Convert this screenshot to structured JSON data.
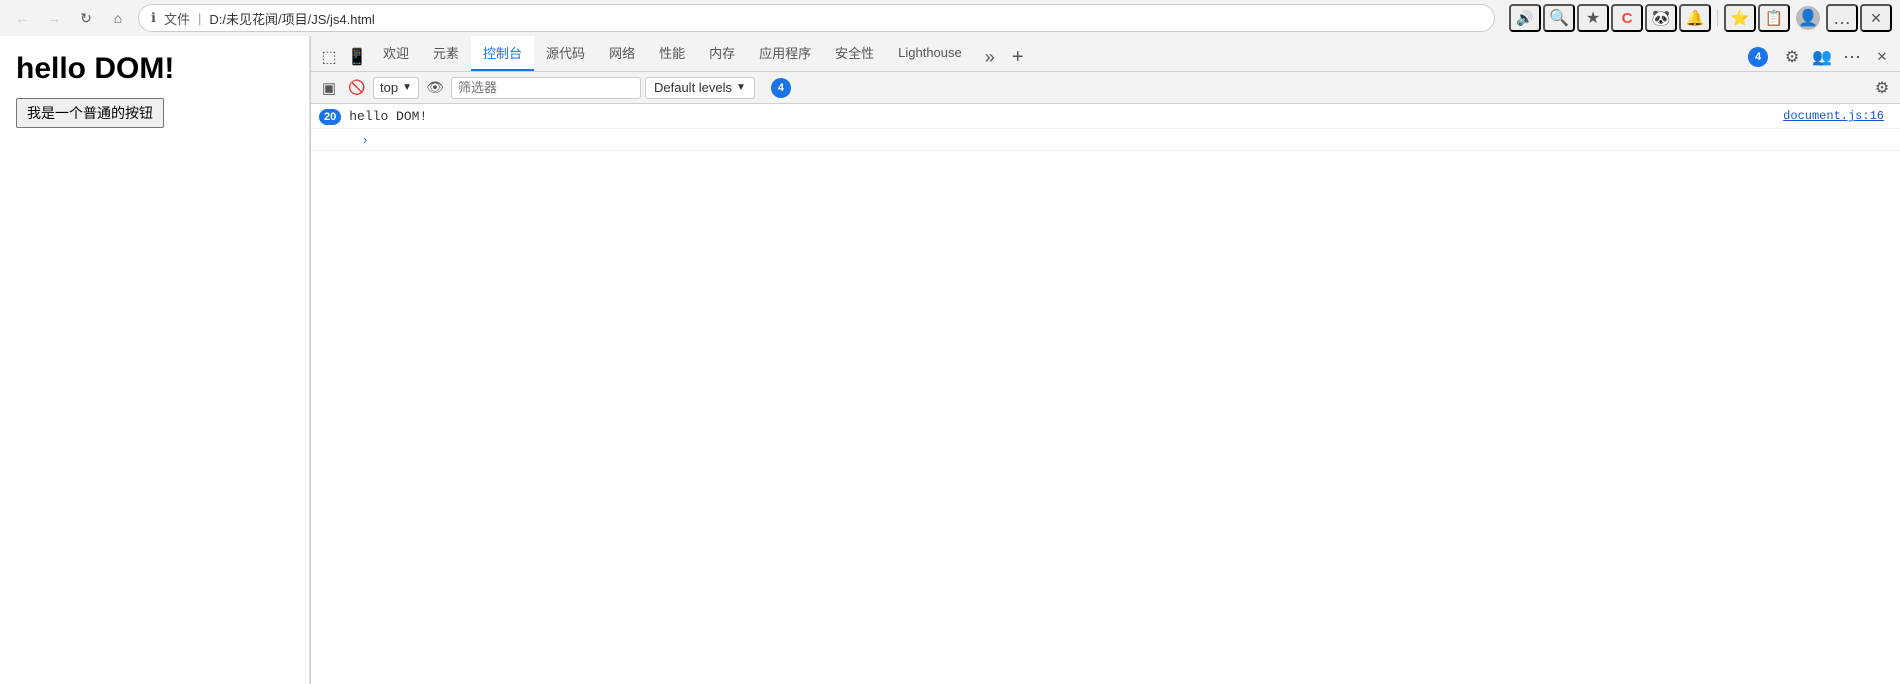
{
  "browser": {
    "back_disabled": true,
    "forward_disabled": true,
    "reload_title": "刷新",
    "home_title": "主页",
    "address": {
      "info_icon": "ℹ",
      "file_label": "文件",
      "separator": "|",
      "url": "D:/未见花闻/项目/JS/js4.html"
    }
  },
  "title_bar_actions": {
    "read_aloud": "📖",
    "search": "🔍",
    "favorites": "☆",
    "brand_icon": "C",
    "ext1": "🐼",
    "ext2": "🔔",
    "fav_star": "★",
    "collections": "🗂",
    "profile": "👤",
    "more": "...",
    "close": "✕"
  },
  "devtools": {
    "icons": {
      "inspect": "⬚",
      "device": "📱",
      "sidebar": "▣"
    },
    "tabs": [
      {
        "label": "欢迎",
        "active": false
      },
      {
        "label": "元素",
        "active": false
      },
      {
        "label": "控制台",
        "active": true
      },
      {
        "label": "源代码",
        "active": false
      },
      {
        "label": "网络",
        "active": false
      },
      {
        "label": "性能",
        "active": false
      },
      {
        "label": "内存",
        "active": false
      },
      {
        "label": "应用程序",
        "active": false
      },
      {
        "label": "安全性",
        "active": false
      },
      {
        "label": "Lighthouse",
        "active": false
      }
    ],
    "more_tabs_icon": "»",
    "add_tab_icon": "+",
    "settings_icon": "⚙",
    "people_icon": "👥",
    "more_icon": "⋯",
    "close_icon": "✕",
    "badge_count": "4"
  },
  "console_toolbar": {
    "sidebar_icon": "▣",
    "clear_icon": "🚫",
    "top_label": "top",
    "eye_icon": "👁",
    "filter_placeholder": "筛选器",
    "levels_label": "Default levels",
    "levels_arrow": "▼",
    "badge_count": "4",
    "settings_icon": "⚙"
  },
  "console_output": {
    "log_count": "20",
    "log_text": "hello DOM!",
    "log_source": "document.js:16",
    "chevron": "›"
  },
  "page": {
    "title": "hello DOM!",
    "button_label": "我是一个普通的按钮"
  }
}
